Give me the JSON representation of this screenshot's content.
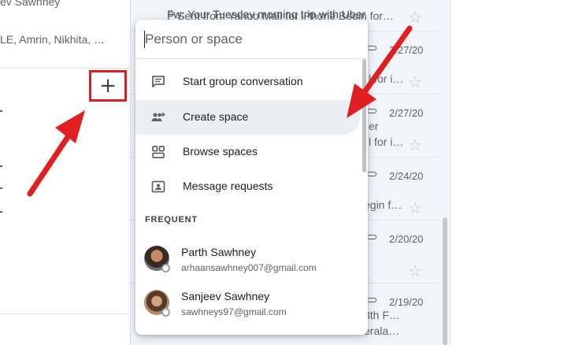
{
  "left_pane": {
    "line1": "ev Sawhney",
    "line2": "LE, Amrin, Nikhita, …",
    "add_symbol": "+"
  },
  "mail_rows": [
    {
      "line1": "Fw: Your Tuesday morning trip with Uber",
      "line2": "P Sent from Yahoo Mail for iPhone Begin for…",
      "date": ""
    },
    {
      "line1": "",
      "line2": "l for i…",
      "date": "2/27/20"
    },
    {
      "line1": "er",
      "line2": "l for i…",
      "date": "2/27/20"
    },
    {
      "line1": "",
      "line2": "egin f…",
      "date": "2/24/20"
    },
    {
      "line1": "",
      "line2": "",
      "date": "2/20/20"
    },
    {
      "line1": "3th F…",
      "line2": "erala…",
      "date": "2/19/20"
    }
  ],
  "menu": {
    "search_placeholder": "Person or space",
    "items": [
      {
        "label": "Start group conversation",
        "icon": "message-icon"
      },
      {
        "label": "Create space",
        "icon": "group-add-icon"
      },
      {
        "label": "Browse spaces",
        "icon": "grid-icon"
      },
      {
        "label": "Message requests",
        "icon": "contact-card-icon"
      }
    ],
    "frequent_heading": "FREQUENT",
    "contacts": [
      {
        "name": "Parth Sawhney",
        "email": "arhaansawhney007@gmail.com"
      },
      {
        "name": "Sanjeev Sawhney",
        "email": "sawhneys97@gmail.com"
      }
    ]
  },
  "colors": {
    "highlight_red": "#e02020",
    "selected_item_bg": "#eceff1",
    "mail_bg": "#f2f6fc"
  }
}
